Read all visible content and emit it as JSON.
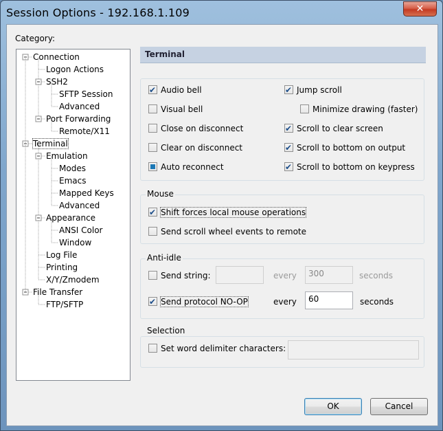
{
  "window": {
    "title": "Session Options - 192.168.1.109",
    "close_symbol": "✕"
  },
  "category": {
    "label": "Category:"
  },
  "tree": [
    {
      "label": "Connection",
      "level": 0
    },
    {
      "label": "Logon Actions",
      "level": 1
    },
    {
      "label": "SSH2",
      "level": 1
    },
    {
      "label": "SFTP Session",
      "level": 2
    },
    {
      "label": "Advanced",
      "level": 2
    },
    {
      "label": "Port Forwarding",
      "level": 1
    },
    {
      "label": "Remote/X11",
      "level": 2
    },
    {
      "label": "Terminal",
      "level": 0,
      "selected": true
    },
    {
      "label": "Emulation",
      "level": 1
    },
    {
      "label": "Modes",
      "level": 2
    },
    {
      "label": "Emacs",
      "level": 2
    },
    {
      "label": "Mapped Keys",
      "level": 2
    },
    {
      "label": "Advanced",
      "level": 2
    },
    {
      "label": "Appearance",
      "level": 1
    },
    {
      "label": "ANSI Color",
      "level": 2
    },
    {
      "label": "Window",
      "level": 2
    },
    {
      "label": "Log File",
      "level": 1
    },
    {
      "label": "Printing",
      "level": 1
    },
    {
      "label": "X/Y/Zmodem",
      "level": 1
    },
    {
      "label": "File Transfer",
      "level": 0
    },
    {
      "label": "FTP/SFTP",
      "level": 1
    }
  ],
  "panel": {
    "title": "Terminal"
  },
  "terminal_options": {
    "audio_bell": {
      "label": "Audio bell",
      "checked": true
    },
    "visual_bell": {
      "label": "Visual bell",
      "checked": false
    },
    "close_on_disconnect": {
      "label": "Close on disconnect",
      "checked": false
    },
    "clear_on_disconnect": {
      "label": "Clear on disconnect",
      "checked": false
    },
    "auto_reconnect": {
      "label": "Auto reconnect",
      "checked": "indeterminate"
    },
    "jump_scroll": {
      "label": "Jump scroll",
      "checked": true
    },
    "minimize_drawing": {
      "label": "Minimize drawing (faster)",
      "checked": false
    },
    "scroll_to_clear": {
      "label": "Scroll to clear screen",
      "checked": true
    },
    "scroll_bottom_output": {
      "label": "Scroll to bottom on output",
      "checked": true
    },
    "scroll_bottom_keypress": {
      "label": "Scroll to bottom on keypress",
      "checked": true
    }
  },
  "mouse": {
    "title": "Mouse",
    "shift_forces": {
      "label": "Shift forces local mouse operations",
      "checked": true
    },
    "scroll_wheel": {
      "label": "Send scroll wheel events to remote",
      "checked": false
    }
  },
  "anti_idle": {
    "title": "Anti-idle",
    "send_string": {
      "label": "Send string:",
      "checked": false,
      "value": "",
      "every": "every",
      "interval": "300",
      "unit": "seconds"
    },
    "send_noop": {
      "label": "Send protocol NO-OP",
      "checked": true,
      "every": "every",
      "interval": "60",
      "unit": "seconds"
    }
  },
  "selection": {
    "title": "Selection",
    "word_delim": {
      "label": "Set word delimiter characters:",
      "checked": false,
      "value": ""
    }
  },
  "buttons": {
    "ok": "OK",
    "cancel": "Cancel"
  }
}
